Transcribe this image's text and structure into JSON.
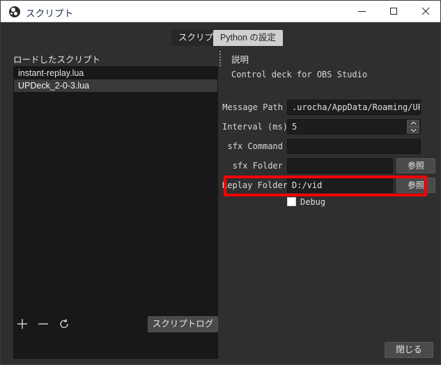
{
  "window": {
    "title": "スクリプト",
    "app_icon": "obs-logo-icon",
    "controls": {
      "minimize": "minimize-icon",
      "maximize": "maximize-icon",
      "close": "close-icon"
    }
  },
  "tabs": [
    {
      "label": "スクリプト",
      "active": true
    },
    {
      "label": "Python の設定",
      "active": false
    }
  ],
  "left_pane": {
    "title": "ロードしたスクリプト",
    "items": [
      {
        "label": "instant-replay.lua",
        "selected": false
      },
      {
        "label": "UPDeck_2-0-3.lua",
        "selected": true
      }
    ],
    "toolbar": {
      "add": "+",
      "remove": "−",
      "reload": "reload-icon",
      "script_log_label": "スクリプトログ"
    }
  },
  "right_pane": {
    "title": "説明",
    "description": "Control deck for OBS Studio",
    "fields": [
      {
        "label": "Message Path",
        "value": ".urocha/AppData/Roaming/UPDeck"
      },
      {
        "label": "Interval (ms)",
        "value": "5"
      },
      {
        "label": "sfx Command",
        "value": ""
      },
      {
        "label": "sfx Folder",
        "value": "",
        "browse_label": "参照"
      },
      {
        "label": "Replay Folder",
        "value": "D:/vid",
        "browse_label": "参照"
      }
    ],
    "debug": {
      "label": "Debug",
      "checked": false
    }
  },
  "footer": {
    "close_label": "閉じる"
  },
  "annotation": {
    "color": "#ff0000",
    "target": "Replay Folder"
  }
}
